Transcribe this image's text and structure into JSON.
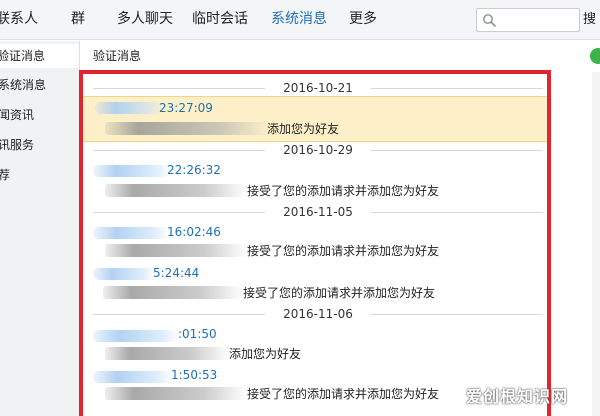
{
  "tabs": [
    {
      "label": "联系人",
      "active": false
    },
    {
      "label": "群",
      "active": false
    },
    {
      "label": "多人聊天",
      "active": false
    },
    {
      "label": "临时会话",
      "active": false
    },
    {
      "label": "系统消息",
      "active": true
    },
    {
      "label": "更多",
      "active": false
    }
  ],
  "search": {
    "icon": "search-icon",
    "button_label": "搜"
  },
  "sidebar": {
    "items": [
      {
        "label": "验证消息",
        "active": true
      },
      {
        "label": "系统消息",
        "active": false
      },
      {
        "label": "闻资讯",
        "active": false
      },
      {
        "label": "讯服务",
        "active": false
      },
      {
        "label": "荐",
        "active": false
      }
    ]
  },
  "main": {
    "title": "验证消息"
  },
  "messages": [
    {
      "date": "2016-10-21"
    },
    {
      "time": "23:27:09",
      "text": "添加您为好友",
      "highlight": true
    },
    {
      "date": "2016-10-29"
    },
    {
      "time": "22:26:32",
      "text": "接受了您的添加请求并添加您为好友"
    },
    {
      "date": "2016-11-05"
    },
    {
      "time": "16:02:46",
      "text": "接受了您的添加请求并添加您为好友"
    },
    {
      "time": "5:24:44",
      "text": "接受了您的添加请求并添加您为好友"
    },
    {
      "date": "2016-11-06"
    },
    {
      "time": ":01:50",
      "text": "添加您为好友"
    },
    {
      "time": "1:50:53",
      "text": "接受了您的添加请求并添加您为好友"
    }
  ],
  "colors": {
    "accent": "#1f6fb8",
    "highlight": "#fdf0c8",
    "annotation": "#e0252e",
    "status": "#3bb34a"
  },
  "watermark": "爱创根知识网"
}
